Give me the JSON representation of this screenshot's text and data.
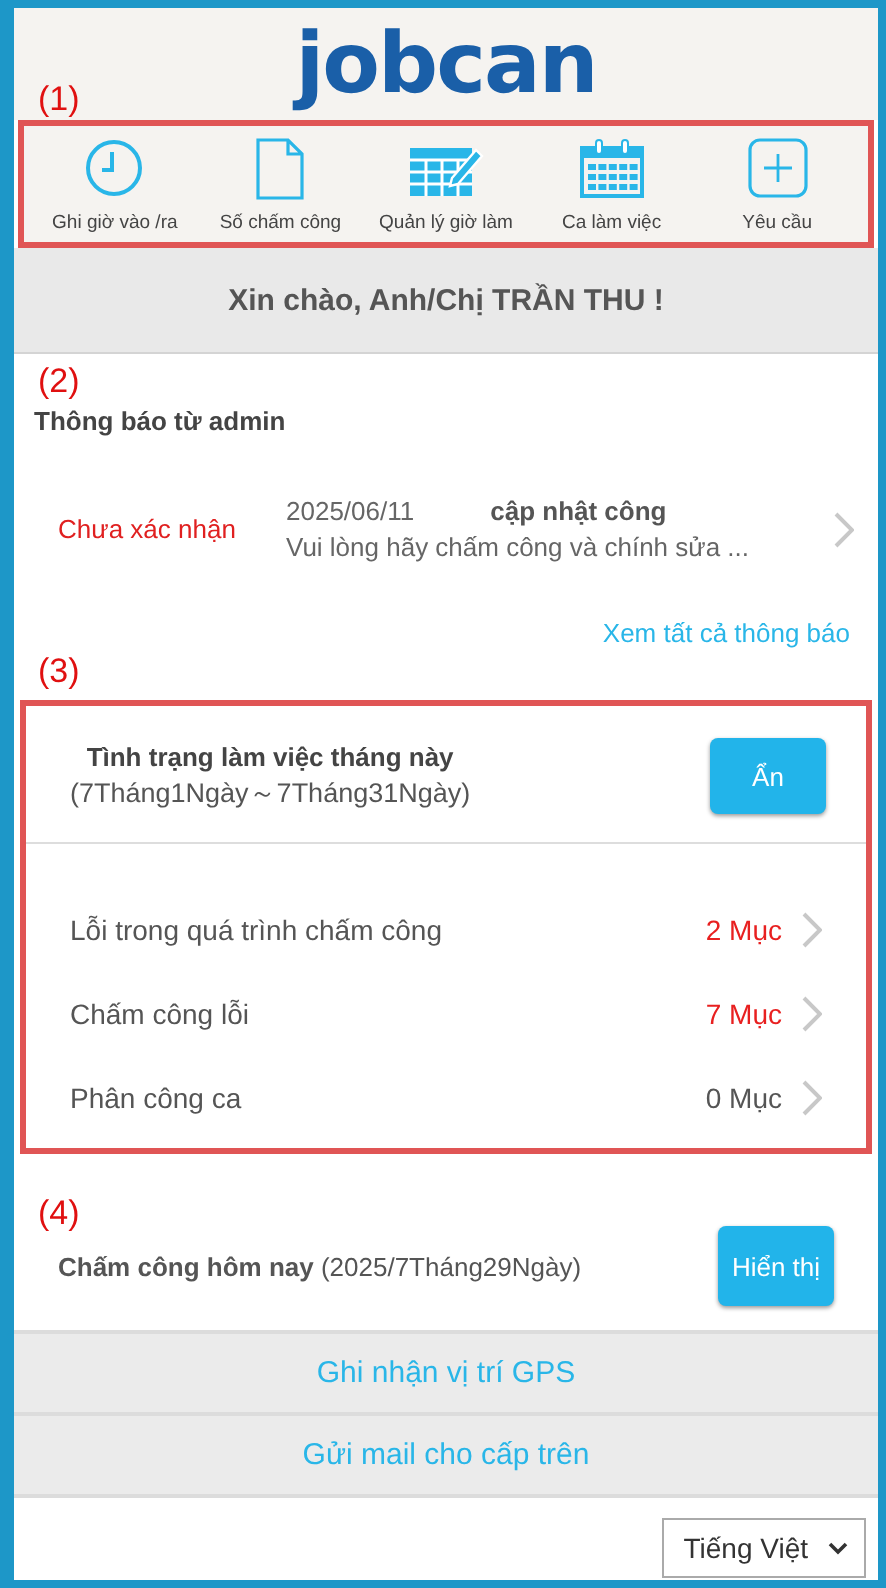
{
  "logo": "jobcan",
  "nav": {
    "annotation": "(1)",
    "outlined": true,
    "items": [
      {
        "kind": "clock",
        "label": "Ghi giờ vào /ra"
      },
      {
        "kind": "document",
        "label": "Số chấm công"
      },
      {
        "kind": "table",
        "label": "Quản lý giờ làm"
      },
      {
        "kind": "calendar",
        "label": "Ca làm việc"
      },
      {
        "kind": "plus",
        "label": "Yêu cầu"
      }
    ]
  },
  "greeting": "Xin chào, Anh/Chị TRẦN THU !",
  "notices": {
    "annotation": "(2)",
    "title": "Thông báo từ admin",
    "items": [
      {
        "status": "Chưa xác nhận",
        "date": "2025/06/11",
        "subject": "cập nhật công",
        "preview": "Vui lòng hãy chấm công và chính sửa ..."
      }
    ],
    "link": "Xem tất cả thông báo"
  },
  "month_status": {
    "annotation": "(3)",
    "outlined": true,
    "title": "Tình trạng làm việc tháng này",
    "period": "(7Tháng1Ngày～7Tháng31Ngày)",
    "button": "Ẩn",
    "rows": [
      {
        "label": "Lỗi trong quá trình chấm công",
        "count": "2 Mục",
        "alert": true
      },
      {
        "label": "Chấm công lỗi",
        "count": "7 Mục",
        "alert": true
      },
      {
        "label": "Phân công ca",
        "count": "0 Mục",
        "alert": false
      }
    ]
  },
  "today": {
    "annotation": "(4)",
    "title": "Chấm công hôm nay",
    "date": "(2025/7Tháng29Ngày)",
    "button": "Hiển thị"
  },
  "actions": [
    "Ghi nhận vị trí GPS",
    "Gửi mail cho cấp trên"
  ],
  "language": "Tiếng Việt"
}
